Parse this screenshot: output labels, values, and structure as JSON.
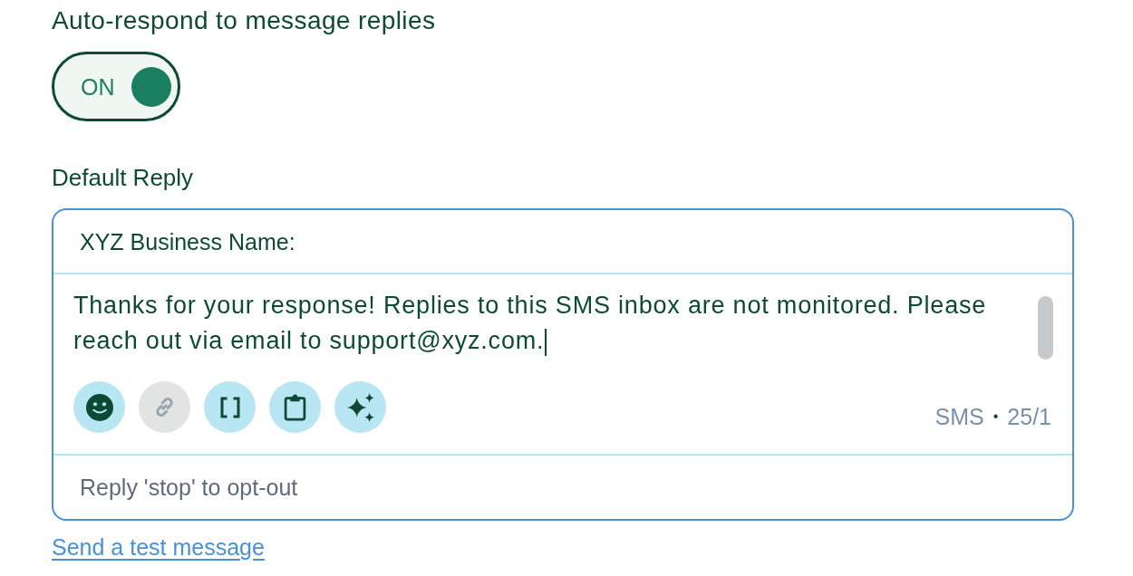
{
  "auto_respond": {
    "title": "Auto-respond to message replies",
    "toggle": {
      "label": "ON",
      "on": true
    }
  },
  "default_reply": {
    "label": "Default Reply",
    "editor": {
      "focused": true,
      "header": "XYZ Business Name:",
      "message": {
        "value": "Thanks for your response! Replies to this SMS inbox are not monitored. Please reach out via email to support@xyz.com."
      },
      "tools": [
        {
          "kind": "emoji",
          "disabled": false
        },
        {
          "kind": "link",
          "disabled": true
        },
        {
          "kind": "brackets",
          "disabled": false
        },
        {
          "kind": "clipboard",
          "disabled": false
        },
        {
          "kind": "sparkles",
          "disabled": false
        }
      ],
      "counter": {
        "channel": "SMS",
        "separator": "•",
        "count": "25/1"
      },
      "footer": "Reply 'stop' to opt-out"
    }
  },
  "test_link": "Send a test message"
}
